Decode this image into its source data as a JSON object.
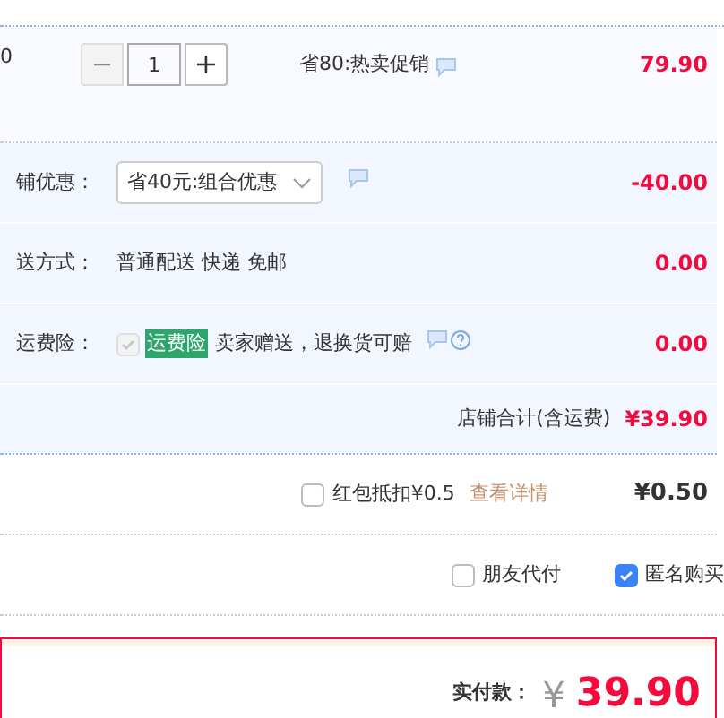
{
  "item": {
    "price_cut": "0",
    "quantity": "1",
    "minus": "—",
    "plus": "+",
    "promo": "省80:热卖促销",
    "subtotal": "79.90"
  },
  "fees": [
    {
      "kind": "select",
      "label": "铺优惠：",
      "value": "省40元:组合优惠",
      "amount": "-40.00"
    },
    {
      "kind": "text",
      "label": "送方式：",
      "value": "普通配送 快递 免邮",
      "amount": "0.00"
    },
    {
      "kind": "insurance",
      "label": "运费险：",
      "tag": "运费险",
      "value": "卖家赠送，退换货可赔",
      "checked": true,
      "disabled": true,
      "amount": "0.00"
    }
  ],
  "store_total": {
    "label": "店铺合计(含运费)",
    "value": "¥39.90"
  },
  "red_packet": {
    "checked": false,
    "label": "红包抵扣¥0.5",
    "link": "查看详情",
    "amount": "¥0.50"
  },
  "options": [
    {
      "label": "朋友代付",
      "checked": false
    },
    {
      "label": "匿名购买",
      "checked": true
    }
  ],
  "pay": {
    "label": "实付款：",
    "currency": "¥",
    "amount": "39.90"
  }
}
